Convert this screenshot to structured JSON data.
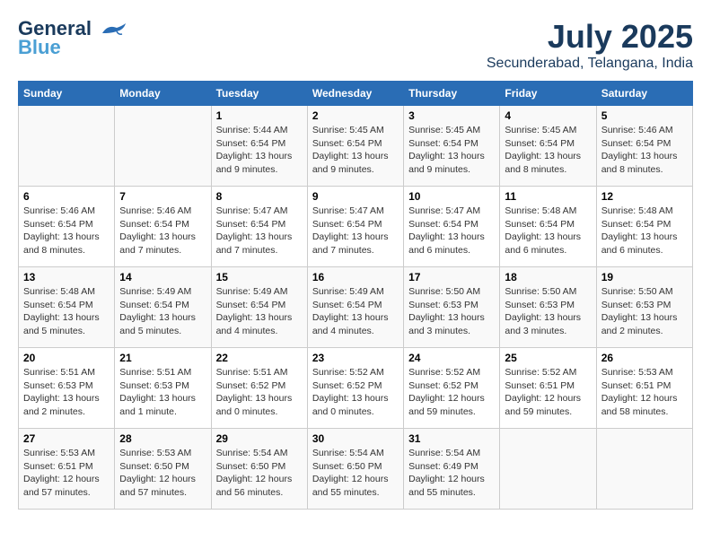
{
  "logo": {
    "line1": "General",
    "line2": "Blue"
  },
  "title": "July 2025",
  "location": "Secunderabad, Telangana, India",
  "headers": [
    "Sunday",
    "Monday",
    "Tuesday",
    "Wednesday",
    "Thursday",
    "Friday",
    "Saturday"
  ],
  "weeks": [
    [
      {
        "day": "",
        "info": ""
      },
      {
        "day": "",
        "info": ""
      },
      {
        "day": "1",
        "info": "Sunrise: 5:44 AM\nSunset: 6:54 PM\nDaylight: 13 hours\nand 9 minutes."
      },
      {
        "day": "2",
        "info": "Sunrise: 5:45 AM\nSunset: 6:54 PM\nDaylight: 13 hours\nand 9 minutes."
      },
      {
        "day": "3",
        "info": "Sunrise: 5:45 AM\nSunset: 6:54 PM\nDaylight: 13 hours\nand 9 minutes."
      },
      {
        "day": "4",
        "info": "Sunrise: 5:45 AM\nSunset: 6:54 PM\nDaylight: 13 hours\nand 8 minutes."
      },
      {
        "day": "5",
        "info": "Sunrise: 5:46 AM\nSunset: 6:54 PM\nDaylight: 13 hours\nand 8 minutes."
      }
    ],
    [
      {
        "day": "6",
        "info": "Sunrise: 5:46 AM\nSunset: 6:54 PM\nDaylight: 13 hours\nand 8 minutes."
      },
      {
        "day": "7",
        "info": "Sunrise: 5:46 AM\nSunset: 6:54 PM\nDaylight: 13 hours\nand 7 minutes."
      },
      {
        "day": "8",
        "info": "Sunrise: 5:47 AM\nSunset: 6:54 PM\nDaylight: 13 hours\nand 7 minutes."
      },
      {
        "day": "9",
        "info": "Sunrise: 5:47 AM\nSunset: 6:54 PM\nDaylight: 13 hours\nand 7 minutes."
      },
      {
        "day": "10",
        "info": "Sunrise: 5:47 AM\nSunset: 6:54 PM\nDaylight: 13 hours\nand 6 minutes."
      },
      {
        "day": "11",
        "info": "Sunrise: 5:48 AM\nSunset: 6:54 PM\nDaylight: 13 hours\nand 6 minutes."
      },
      {
        "day": "12",
        "info": "Sunrise: 5:48 AM\nSunset: 6:54 PM\nDaylight: 13 hours\nand 6 minutes."
      }
    ],
    [
      {
        "day": "13",
        "info": "Sunrise: 5:48 AM\nSunset: 6:54 PM\nDaylight: 13 hours\nand 5 minutes."
      },
      {
        "day": "14",
        "info": "Sunrise: 5:49 AM\nSunset: 6:54 PM\nDaylight: 13 hours\nand 5 minutes."
      },
      {
        "day": "15",
        "info": "Sunrise: 5:49 AM\nSunset: 6:54 PM\nDaylight: 13 hours\nand 4 minutes."
      },
      {
        "day": "16",
        "info": "Sunrise: 5:49 AM\nSunset: 6:54 PM\nDaylight: 13 hours\nand 4 minutes."
      },
      {
        "day": "17",
        "info": "Sunrise: 5:50 AM\nSunset: 6:53 PM\nDaylight: 13 hours\nand 3 minutes."
      },
      {
        "day": "18",
        "info": "Sunrise: 5:50 AM\nSunset: 6:53 PM\nDaylight: 13 hours\nand 3 minutes."
      },
      {
        "day": "19",
        "info": "Sunrise: 5:50 AM\nSunset: 6:53 PM\nDaylight: 13 hours\nand 2 minutes."
      }
    ],
    [
      {
        "day": "20",
        "info": "Sunrise: 5:51 AM\nSunset: 6:53 PM\nDaylight: 13 hours\nand 2 minutes."
      },
      {
        "day": "21",
        "info": "Sunrise: 5:51 AM\nSunset: 6:53 PM\nDaylight: 13 hours\nand 1 minute."
      },
      {
        "day": "22",
        "info": "Sunrise: 5:51 AM\nSunset: 6:52 PM\nDaylight: 13 hours\nand 0 minutes."
      },
      {
        "day": "23",
        "info": "Sunrise: 5:52 AM\nSunset: 6:52 PM\nDaylight: 13 hours\nand 0 minutes."
      },
      {
        "day": "24",
        "info": "Sunrise: 5:52 AM\nSunset: 6:52 PM\nDaylight: 12 hours\nand 59 minutes."
      },
      {
        "day": "25",
        "info": "Sunrise: 5:52 AM\nSunset: 6:51 PM\nDaylight: 12 hours\nand 59 minutes."
      },
      {
        "day": "26",
        "info": "Sunrise: 5:53 AM\nSunset: 6:51 PM\nDaylight: 12 hours\nand 58 minutes."
      }
    ],
    [
      {
        "day": "27",
        "info": "Sunrise: 5:53 AM\nSunset: 6:51 PM\nDaylight: 12 hours\nand 57 minutes."
      },
      {
        "day": "28",
        "info": "Sunrise: 5:53 AM\nSunset: 6:50 PM\nDaylight: 12 hours\nand 57 minutes."
      },
      {
        "day": "29",
        "info": "Sunrise: 5:54 AM\nSunset: 6:50 PM\nDaylight: 12 hours\nand 56 minutes."
      },
      {
        "day": "30",
        "info": "Sunrise: 5:54 AM\nSunset: 6:50 PM\nDaylight: 12 hours\nand 55 minutes."
      },
      {
        "day": "31",
        "info": "Sunrise: 5:54 AM\nSunset: 6:49 PM\nDaylight: 12 hours\nand 55 minutes."
      },
      {
        "day": "",
        "info": ""
      },
      {
        "day": "",
        "info": ""
      }
    ]
  ]
}
